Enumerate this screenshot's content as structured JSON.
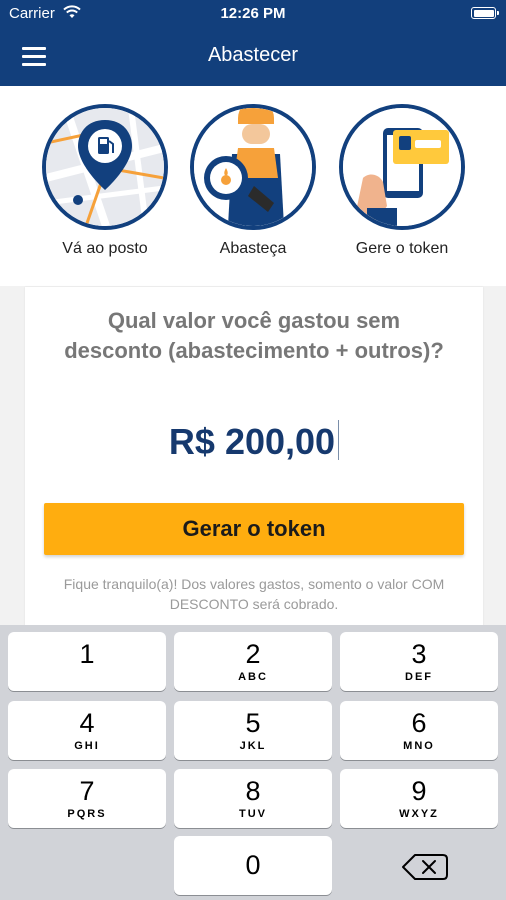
{
  "status_bar": {
    "carrier": "Carrier",
    "time": "12:26 PM"
  },
  "nav": {
    "title": "Abastecer"
  },
  "steps": [
    {
      "label": "Vá ao posto",
      "icon": "fuel-location-pin-icon"
    },
    {
      "label": "Abasteça",
      "icon": "gas-attendant-icon"
    },
    {
      "label": "Gere o token",
      "icon": "phone-token-icon"
    }
  ],
  "form": {
    "question": "Qual valor você gastou sem desconto (abastecimento + outros)?",
    "amount": "R$ 200,00",
    "button_label": "Gerar o token",
    "note": "Fique tranquilo(a)! Dos valores gastos, somento o valor COM DESCONTO será cobrado."
  },
  "keypad": {
    "keys": [
      {
        "num": "1",
        "letters": ""
      },
      {
        "num": "2",
        "letters": "ABC"
      },
      {
        "num": "3",
        "letters": "DEF"
      },
      {
        "num": "4",
        "letters": "GHI"
      },
      {
        "num": "5",
        "letters": "JKL"
      },
      {
        "num": "6",
        "letters": "MNO"
      },
      {
        "num": "7",
        "letters": "PQRS"
      },
      {
        "num": "8",
        "letters": "TUV"
      },
      {
        "num": "9",
        "letters": "WXYZ"
      },
      {
        "num": "0",
        "letters": ""
      }
    ]
  },
  "colors": {
    "primary": "#123f7c",
    "accent": "#ffad0f"
  }
}
